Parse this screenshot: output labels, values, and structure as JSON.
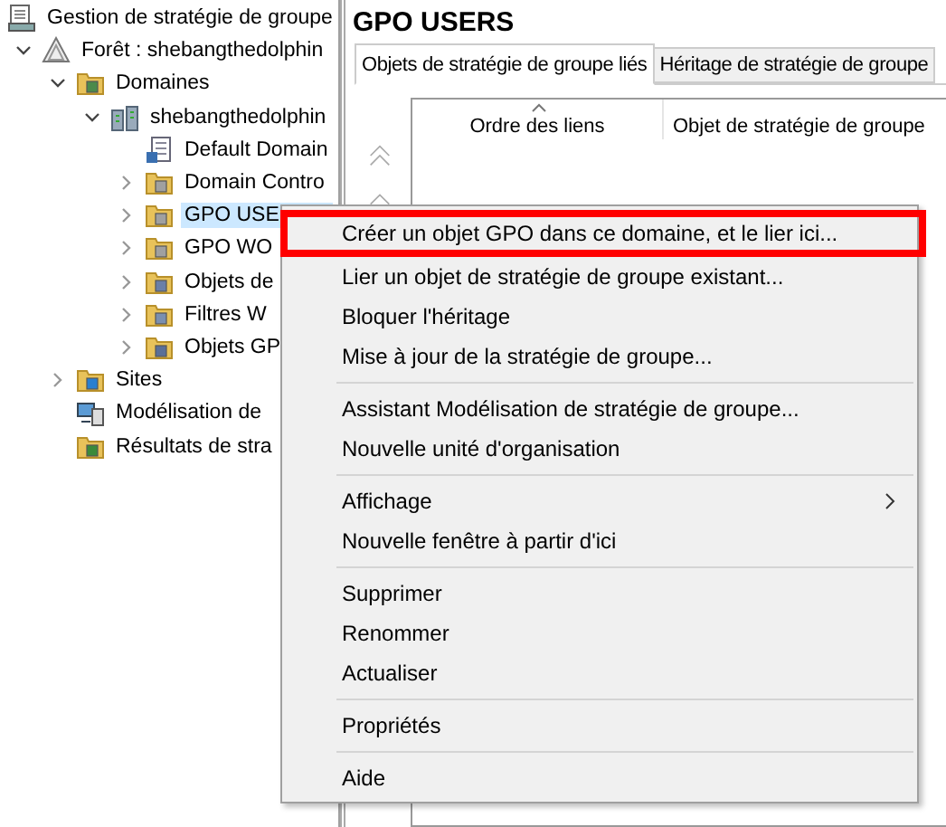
{
  "tree": [
    {
      "label": "Gestion de stratégie de groupe",
      "kind": "console",
      "selected": false,
      "children": [
        {
          "label": "Forêt : shebangthedolphin",
          "kind": "forest",
          "expanded": true,
          "selected": false,
          "children": [
            {
              "label": "Domaines",
              "kind": "domains",
              "expanded": true,
              "selected": false,
              "children": [
                {
                  "label": "shebangthedolphin",
                  "kind": "domain",
                  "expanded": true,
                  "selected": false,
                  "children": [
                    {
                      "label": "Default Domain",
                      "kind": "gpo",
                      "selected": false
                    },
                    {
                      "label": "Domain Contro",
                      "kind": "ou",
                      "expanded": false,
                      "selected": false
                    },
                    {
                      "label": "GPO USE",
                      "kind": "ou",
                      "expanded": false,
                      "selected": true
                    },
                    {
                      "label": "GPO WO",
                      "kind": "ou",
                      "expanded": false,
                      "selected": false
                    },
                    {
                      "label": "Objets de",
                      "kind": "gpo-folder",
                      "expanded": false,
                      "selected": false
                    },
                    {
                      "label": "Filtres W",
                      "kind": "wmi-folder",
                      "expanded": false,
                      "selected": false
                    },
                    {
                      "label": "Objets GP",
                      "kind": "starter-folder",
                      "expanded": false,
                      "selected": false
                    }
                  ]
                }
              ]
            },
            {
              "label": "Sites",
              "kind": "sites",
              "expanded": false,
              "selected": false
            },
            {
              "label": "Modélisation de",
              "kind": "modeling",
              "selected": false
            },
            {
              "label": "Résultats de stra",
              "kind": "results",
              "selected": false
            }
          ]
        }
      ]
    }
  ],
  "detail": {
    "title": "GPO USERS",
    "tabs": [
      {
        "label": "Objets de stratégie de groupe liés",
        "selected": true
      },
      {
        "label": "Héritage de stratégie de groupe",
        "selected": false
      }
    ],
    "columns": [
      "Ordre des liens",
      "Objet de stratégie de groupe"
    ]
  },
  "menu": {
    "groups": [
      {
        "items": [
          {
            "label": "Créer un objet GPO dans ce domaine, et le lier ici...",
            "highlighted": true,
            "submenu": false
          },
          {
            "label": "Lier un objet de stratégie de groupe existant...",
            "highlighted": false,
            "submenu": false
          },
          {
            "label": "Bloquer l'héritage",
            "highlighted": false,
            "submenu": false
          },
          {
            "label": "Mise à jour de la stratégie de groupe...",
            "highlighted": false,
            "submenu": false
          }
        ]
      },
      {
        "items": [
          {
            "label": "Assistant Modélisation de stratégie de groupe...",
            "highlighted": false,
            "submenu": false
          },
          {
            "label": "Nouvelle unité d'organisation",
            "highlighted": false,
            "submenu": false
          }
        ]
      },
      {
        "items": [
          {
            "label": "Affichage",
            "highlighted": false,
            "submenu": true
          },
          {
            "label": "Nouvelle fenêtre à partir d'ici",
            "highlighted": false,
            "submenu": false
          }
        ]
      },
      {
        "items": [
          {
            "label": "Supprimer",
            "highlighted": false,
            "submenu": false
          },
          {
            "label": "Renommer",
            "highlighted": false,
            "submenu": false
          },
          {
            "label": "Actualiser",
            "highlighted": false,
            "submenu": false
          }
        ]
      },
      {
        "items": [
          {
            "label": "Propriétés",
            "highlighted": false,
            "submenu": false
          }
        ]
      },
      {
        "items": [
          {
            "label": "Aide",
            "highlighted": false,
            "submenu": false
          }
        ]
      }
    ]
  }
}
